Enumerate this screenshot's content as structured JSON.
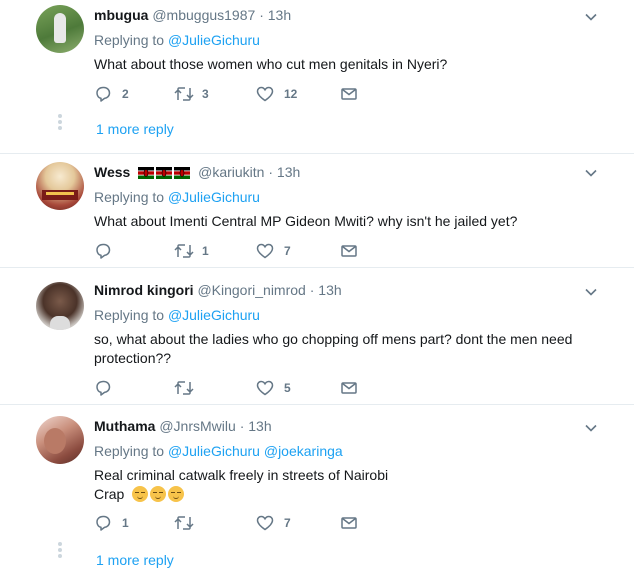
{
  "tweets": [
    {
      "name": "mbugua",
      "handle": "@mbuggus1987",
      "dot": "·",
      "time": "13h",
      "replying_prefix": "Replying to ",
      "replying_to": [
        "@JulieGichuru"
      ],
      "text": "What about those women who cut men genitals in Nyeri?",
      "replies": "2",
      "retweets": "3",
      "likes": "12",
      "more_replies": "1 more reply"
    },
    {
      "name": "Wess",
      "handle": "@kariukitn",
      "dot": "·",
      "time": "13h",
      "replying_prefix": "Replying to ",
      "replying_to": [
        "@JulieGichuru"
      ],
      "text": "What about Imenti Central MP Gideon Mwiti? why isn't he jailed yet?",
      "replies": "",
      "retweets": "1",
      "likes": "7"
    },
    {
      "name": "Nimrod kingori",
      "handle": "@Kingori_nimrod",
      "dot": "·",
      "time": "13h",
      "replying_prefix": "Replying to ",
      "replying_to": [
        "@JulieGichuru"
      ],
      "text_line1": "so, what about the ladies who go chopping off mens part? dont the men need",
      "text_line2": "protection??",
      "replies": "",
      "retweets": "",
      "likes": "5"
    },
    {
      "name": "Muthama",
      "handle": "@JnrsMwilu",
      "dot": "·",
      "time": "13h",
      "replying_prefix": "Replying to ",
      "replying_to": [
        "@JulieGichuru",
        "@joekaringa"
      ],
      "text_line1": "Real criminal catwalk freely in streets of Nairobi",
      "text_line2": "Crap",
      "replies": "1",
      "retweets": "",
      "likes": "7",
      "more_replies": "1 more reply"
    }
  ],
  "colors": {
    "link": "#1da1f2",
    "muted": "#657786",
    "border": "#e6ecf0"
  },
  "icons": [
    "reply-icon",
    "retweet-icon",
    "like-icon",
    "direct-message-icon",
    "chevron-down-icon",
    "kenya-flag-icon",
    "smirking-face-emoji"
  ]
}
